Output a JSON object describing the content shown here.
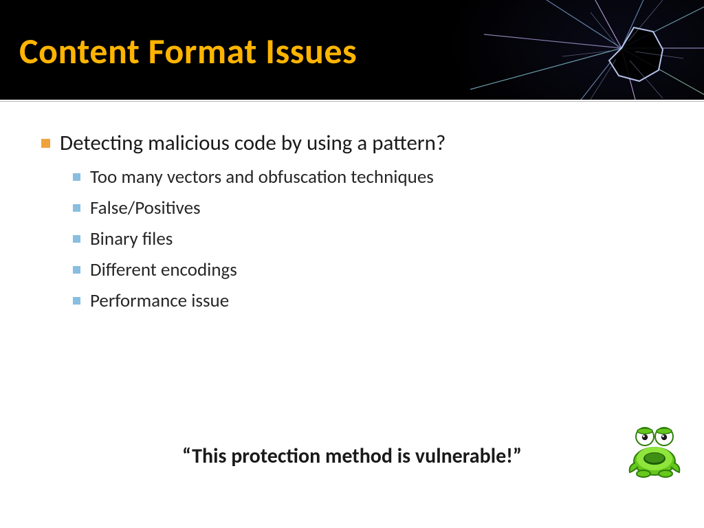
{
  "header": {
    "title": "Content Format Issues"
  },
  "body": {
    "main_point": "Detecting malicious code by using a pattern?",
    "sub_points": [
      "Too many vectors and obfuscation techniques",
      "False/Positives",
      "Binary files",
      "Different encodings",
      "Performance issue"
    ],
    "conclusion": "“This protection method is vulnerable!”"
  },
  "icons": {
    "frog_alt": "shocked-frog"
  }
}
